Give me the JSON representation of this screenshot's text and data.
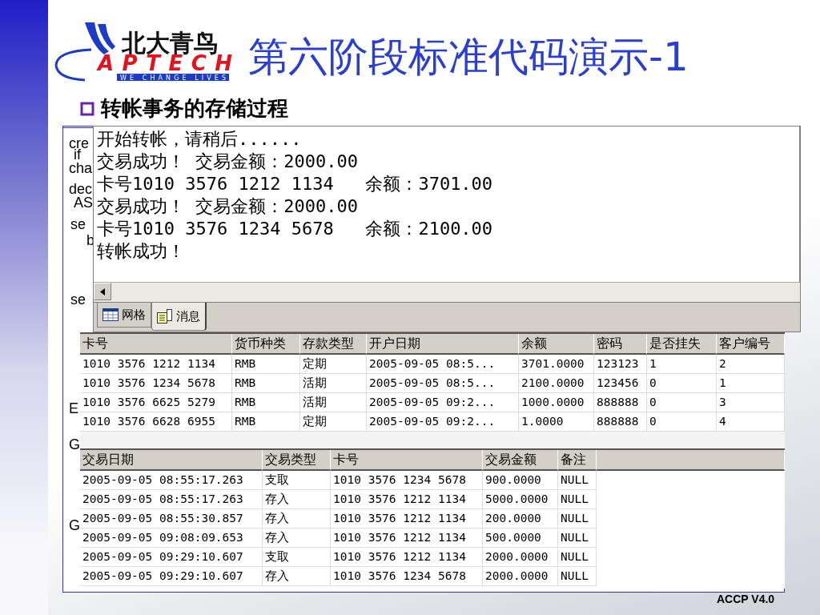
{
  "logo": {
    "name": "北大青鸟",
    "brand": "APTECH",
    "tagline": "WE CHANGE LIVES"
  },
  "title": "第六阶段标准代码演示-1",
  "bullet": "转帐事务的存储过程",
  "code_fragments": [
    "cre",
    "if",
    "cha",
    "dec",
    "AS",
    "se",
    "b",
    "se",
    "E",
    "G",
    "G"
  ],
  "messages": {
    "lines": [
      "开始转帐，请稍后......",
      "交易成功！ 交易金额：2000.00",
      "卡号1010 3576 1212 1134   余额：3701.00",
      "交易成功！ 交易金额：2000.00",
      "卡号1010 3576 1234 5678   余额：2100.00",
      "转帐成功！"
    ],
    "tabs": [
      {
        "kind": "grid",
        "label": "网格",
        "selected": false
      },
      {
        "kind": "messages",
        "label": "消息",
        "selected": true
      }
    ]
  },
  "grids": [
    {
      "columns": [
        "卡号",
        "货币种类",
        "存款类型",
        "开户日期",
        "余额",
        "密码",
        "是否挂失",
        "客户编号"
      ],
      "rows": [
        [
          "1010 3576 1212 1134",
          "RMB",
          "定期",
          "2005-09-05 08:5...",
          "3701.0000",
          "123123",
          "1",
          "2"
        ],
        [
          "1010 3576 1234 5678",
          "RMB",
          "活期",
          "2005-09-05 08:5...",
          "2100.0000",
          "123456",
          "0",
          "1"
        ],
        [
          "1010 3576 6625 5279",
          "RMB",
          "活期",
          "2005-09-05 09:2...",
          "1000.0000",
          "888888",
          "0",
          "3"
        ],
        [
          "1010 3576 6628 6955",
          "RMB",
          "定期",
          "2005-09-05 09:2...",
          "1.0000",
          "888888",
          "0",
          "4"
        ]
      ]
    },
    {
      "columns": [
        "交易日期",
        "交易类型",
        "卡号",
        "交易金额",
        "备注"
      ],
      "rows": [
        [
          "2005-09-05 08:55:17.263",
          "支取",
          "1010 3576 1234 5678",
          "900.0000",
          "NULL"
        ],
        [
          "2005-09-05 08:55:17.263",
          "存入",
          "1010 3576 1212 1134",
          "5000.0000",
          "NULL"
        ],
        [
          "2005-09-05 08:55:30.857",
          "存入",
          "1010 3576 1212 1134",
          "200.0000",
          "NULL"
        ],
        [
          "2005-09-05 09:08:09.653",
          "存入",
          "1010 3576 1212 1134",
          "500.0000",
          "NULL"
        ],
        [
          "2005-09-05 09:29:10.607",
          "支取",
          "1010 3576 1212 1134",
          "2000.0000",
          "NULL"
        ],
        [
          "2005-09-05 09:29:10.607",
          "存入",
          "1010 3576 1234 5678",
          "2000.0000",
          "NULL"
        ]
      ]
    }
  ],
  "footer": "ACCP V4.0"
}
